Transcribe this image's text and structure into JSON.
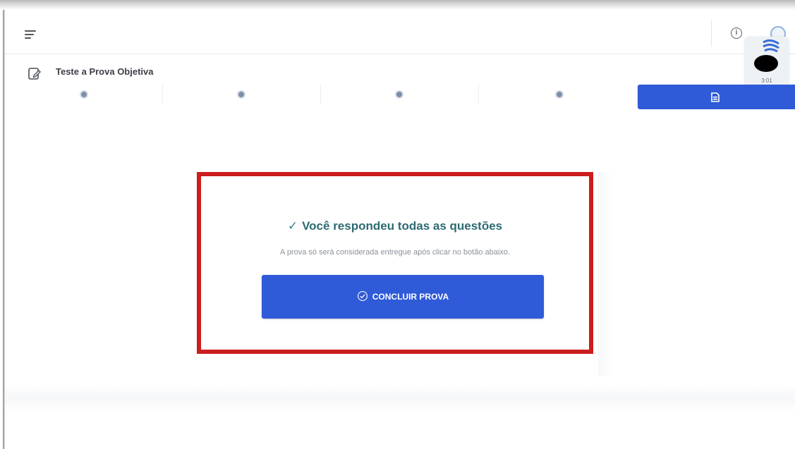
{
  "exam": {
    "title": "Teste a Prova Objetiva"
  },
  "question_nav": {
    "items": [
      {
        "state": "answered"
      },
      {
        "state": "answered"
      },
      {
        "state": "answered"
      },
      {
        "state": "answered"
      }
    ],
    "active_icon": "document-icon"
  },
  "camera": {
    "timer": "3:01"
  },
  "completion": {
    "title": "Você respondeu todas as questões",
    "subtitle": "A prova só será considerada entregue após clicar no botão abaixo.",
    "button_label": "CONCLUIR PROVA"
  },
  "colors": {
    "primary": "#2f5ad8",
    "highlight_border": "#cc1d1d",
    "title_text": "#2d6b72"
  }
}
